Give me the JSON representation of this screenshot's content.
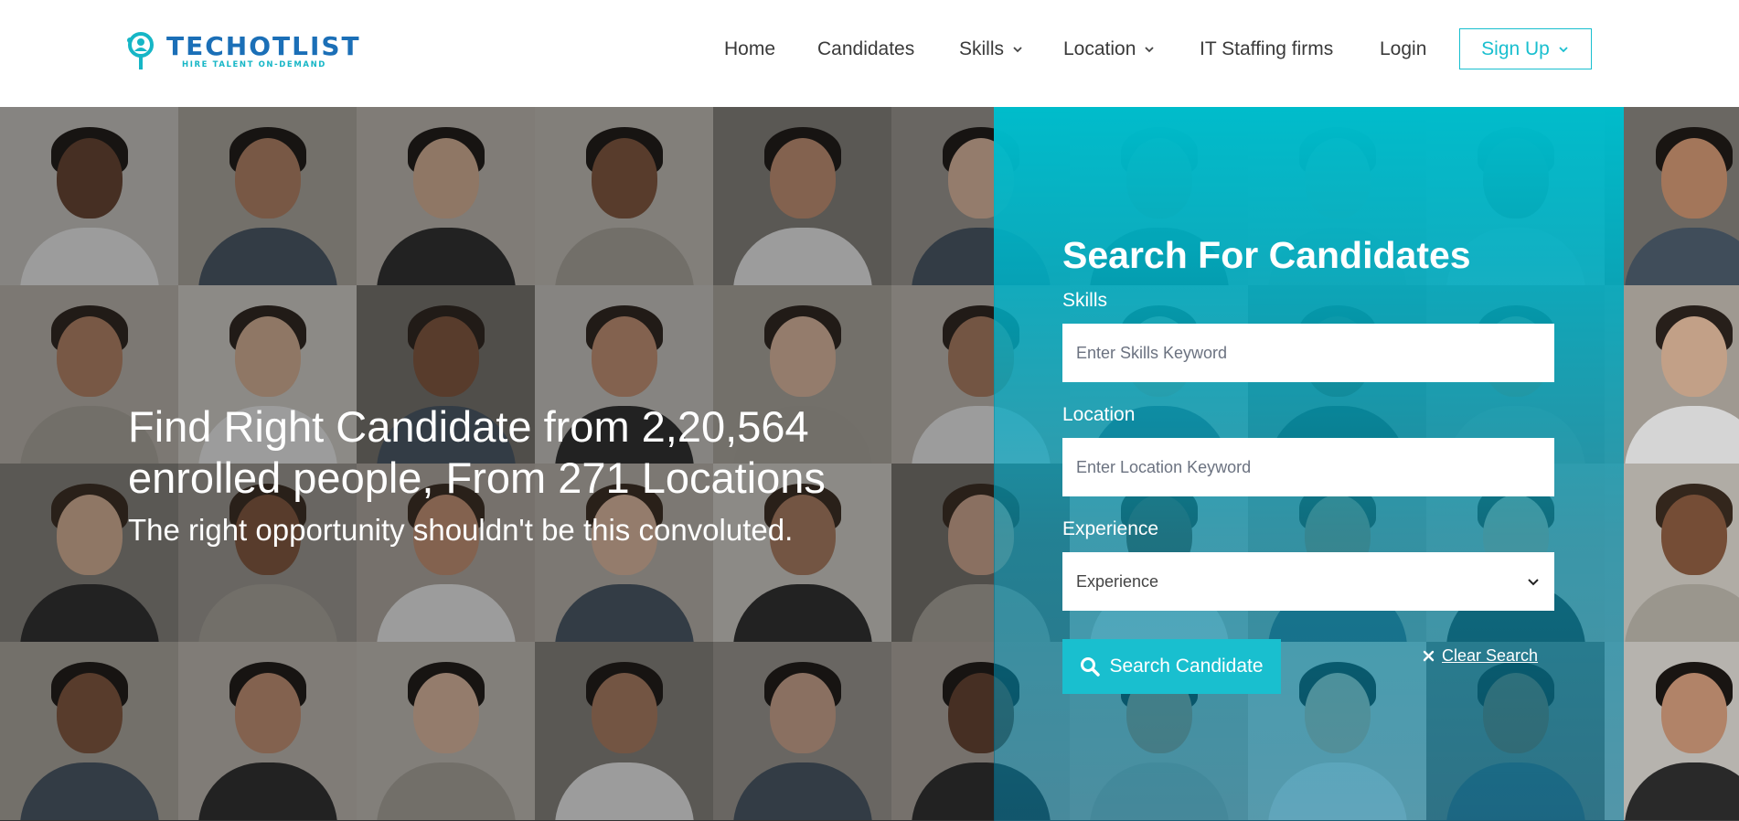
{
  "brand": {
    "name": "TECHOTLIST",
    "tagline": "HIRE TALENT ON-DEMAND",
    "primary_color": "#1b6fb7",
    "accent_color": "#19bfcf"
  },
  "nav": {
    "items": [
      {
        "label": "Home",
        "has_dropdown": false
      },
      {
        "label": "Candidates",
        "has_dropdown": false
      },
      {
        "label": "Skills",
        "has_dropdown": true
      },
      {
        "label": "Location",
        "has_dropdown": true
      },
      {
        "label": "IT Staffing firms",
        "has_dropdown": false
      },
      {
        "label": "Login",
        "has_dropdown": false
      }
    ],
    "signup_label": "Sign Up"
  },
  "hero": {
    "headline": "Find Right Candidate from 2,20,564 enrolled people, From 271 Locations",
    "subline": "The right opportunity shouldn't be this convoluted."
  },
  "search_form": {
    "title": "Search For Candidates",
    "skills_label": "Skills",
    "skills_placeholder": "Enter Skills Keyword",
    "location_label": "Location",
    "location_placeholder": "Enter Location Keyword",
    "experience_label": "Experience",
    "experience_selected": "Experience",
    "search_button": "Search Candidate",
    "clear_link": "Clear Search"
  }
}
